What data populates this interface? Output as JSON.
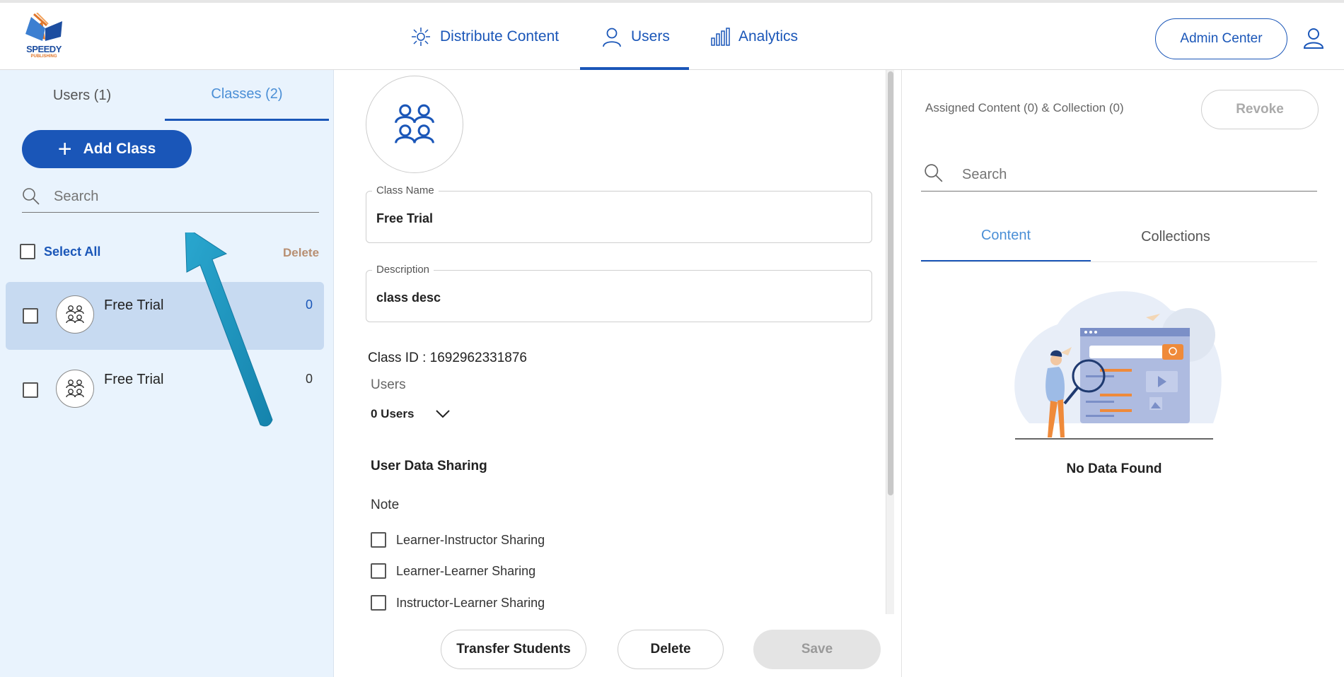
{
  "brand": {
    "name": "SPEEDY",
    "sub": "PUBLISHING",
    "accent": "#1a56b8"
  },
  "nav": {
    "distribute": "Distribute Content",
    "users": "Users",
    "analytics": "Analytics",
    "admin_center": "Admin Center"
  },
  "sidebar": {
    "tabs": {
      "users": "Users (1)",
      "classes": "Classes (2)"
    },
    "add_class": "Add Class",
    "search_placeholder": "Search",
    "select_all": "Select All",
    "delete": "Delete",
    "classes": [
      {
        "name": "Free Trial",
        "count": "0",
        "selected": true
      },
      {
        "name": "Free Trial",
        "count": "0",
        "selected": false
      }
    ]
  },
  "detail": {
    "class_name_label": "Class Name",
    "class_name": "Free Trial",
    "description_label": "Description",
    "description": "class desc",
    "class_id": "Class ID : 1692962331876",
    "users_label": "Users",
    "users_count": "0 Users",
    "user_data_sharing": "User Data Sharing",
    "note": "Note",
    "sharing_options": [
      "Learner-Instructor Sharing",
      "Learner-Learner Sharing",
      "Instructor-Learner Sharing"
    ],
    "buttons": {
      "transfer": "Transfer Students",
      "delete": "Delete",
      "save": "Save"
    }
  },
  "assigned": {
    "title": "Assigned Content (0) & Collection (0)",
    "revoke": "Revoke",
    "search_placeholder": "Search",
    "tabs": {
      "content": "Content",
      "collections": "Collections"
    },
    "empty": "No Data Found"
  }
}
